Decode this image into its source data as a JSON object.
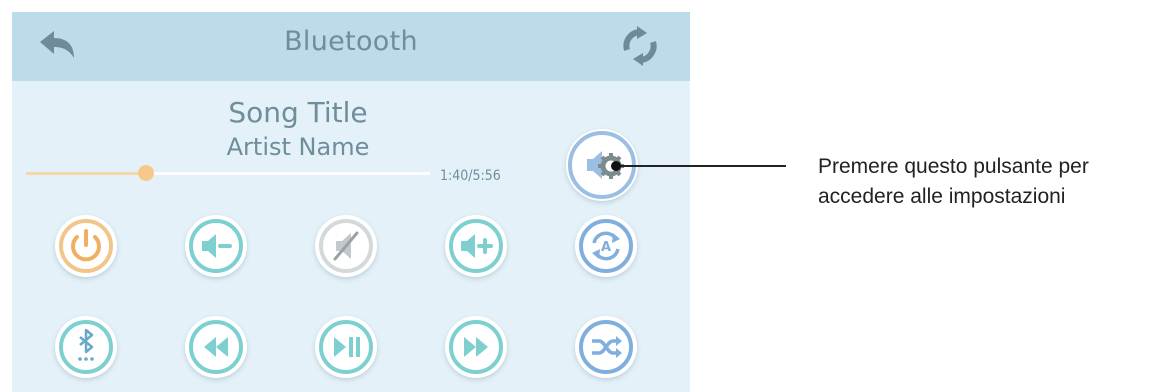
{
  "header": {
    "title": "Bluetooth",
    "back_icon": "back-arrow-icon",
    "refresh_icon": "refresh-icon"
  },
  "track": {
    "song_title": "Song Title",
    "artist_name": "Artist Name",
    "time": "1:40/5:56",
    "progress": 0.297
  },
  "buttons_row1": [
    {
      "name": "power-button",
      "icon": "power-icon"
    },
    {
      "name": "volume-down-button",
      "icon": "volume-down-icon"
    },
    {
      "name": "mute-button",
      "icon": "mute-icon"
    },
    {
      "name": "volume-up-button",
      "icon": "volume-up-icon"
    },
    {
      "name": "auto-repeat-button",
      "icon": "auto-repeat-icon"
    }
  ],
  "buttons_row2": [
    {
      "name": "bluetooth-pair-button",
      "icon": "bluetooth-icon"
    },
    {
      "name": "rewind-button",
      "icon": "rewind-icon"
    },
    {
      "name": "play-pause-button",
      "icon": "play-pause-icon"
    },
    {
      "name": "fast-forward-button",
      "icon": "fast-forward-icon"
    },
    {
      "name": "shuffle-button",
      "icon": "shuffle-icon"
    }
  ],
  "settings": {
    "icon": "audio-settings-icon"
  },
  "callout": {
    "line1": "Premere questo pulsante per",
    "line2": "accedere alle impostazioni"
  },
  "colors": {
    "screen_bg": "#e4f1f8",
    "header_bg": "#bcdcec",
    "text": "#6f8e9b",
    "power": "#f0b86e",
    "teal": "#7ecfcf",
    "blue": "#80aedd",
    "gray": "#c7cdd0",
    "progress_thumb": "#f6c98b"
  }
}
